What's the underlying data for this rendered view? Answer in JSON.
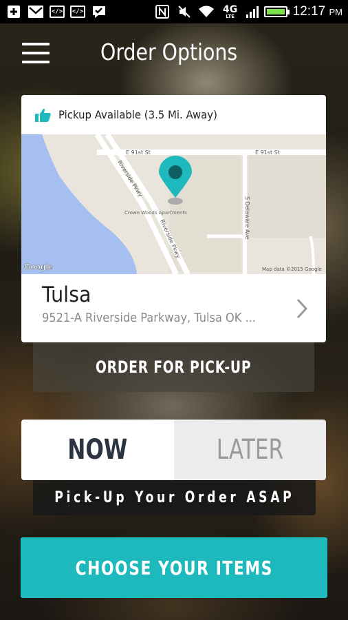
{
  "status_bar": {
    "time": "12:17",
    "ampm": "PM",
    "network": "4G",
    "network_sub": "LTE",
    "icons": [
      "add-icon",
      "gmail-icon",
      "code-icon",
      "code-icon",
      "bbm-icon",
      "nfc-icon",
      "no-sound-icon",
      "wifi-icon",
      "signal-icon",
      "battery-icon"
    ]
  },
  "header": {
    "title": "Order Options",
    "menu_icon": "hamburger-menu-icon"
  },
  "store_card": {
    "pickup_label": "Pickup Available (3.5 Mi. Away)",
    "store_name": "Tulsa",
    "address": "9521-A Riverside Parkway, Tulsa OK ...",
    "map": {
      "street_e91": "E 91st St",
      "street_e91_b": "E 91st St",
      "street_riverside": "Riverside Pkwy",
      "street_riverside_b": "Riverside Pkwy",
      "street_delaware": "S Delaware Ave",
      "poi": "Crown Woods Apartments",
      "attribution": "Map data ©2015 Google",
      "logo": "Google"
    },
    "accent_color": "#1eb9bd"
  },
  "order_for_pickup_label": "ORDER FOR PICK-UP",
  "timing": {
    "now_label": "NOW",
    "later_label": "LATER",
    "selected": "NOW",
    "description": "Pick-Up Your Order ASAP"
  },
  "choose_items_label": "CHOOSE YOUR ITEMS"
}
